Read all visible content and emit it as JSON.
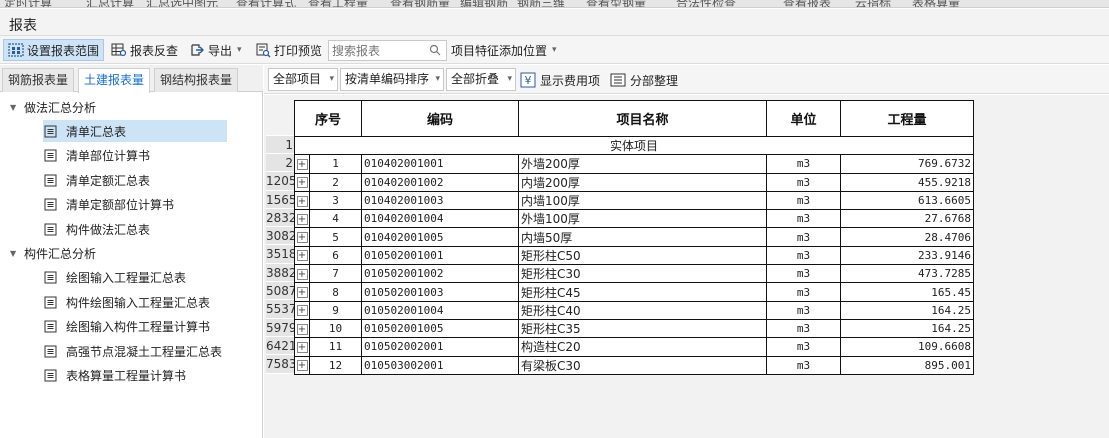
{
  "top_menu": [
    "定时计算",
    "汇总计算",
    "汇总选中图元",
    "查看计算式",
    "查看工程量",
    "查看钢筋量",
    "编辑钢筋",
    "钢筋三维",
    "查看型钢量",
    "合法性检查",
    "查看报表",
    "云指标",
    "表格算量"
  ],
  "window_title": "报表",
  "toolbar": {
    "set_range": "设置报表范围",
    "reverse_check": "报表反查",
    "export": "导出",
    "print_preview": "打印预览",
    "search_placeholder": "搜索报表",
    "feature_position": "项目特征添加位置"
  },
  "left_tabs": [
    "钢筋报表量",
    "土建报表量",
    "钢结构报表量"
  ],
  "tree": {
    "group1": "做法汇总分析",
    "group1_items": [
      "清单汇总表",
      "清单部位计算书",
      "清单定额汇总表",
      "清单定额部位计算书",
      "构件做法汇总表"
    ],
    "group2": "构件汇总分析",
    "group2_items": [
      "绘图输入工程量汇总表",
      "构件绘图输入工程量汇总表",
      "绘图输入构件工程量计算书",
      "高强节点混凝土工程量汇总表",
      "表格算量工程量计算书"
    ]
  },
  "right_toolbar": {
    "all_items": "全部项目",
    "sort": "按清单编码排序",
    "fold": "全部折叠",
    "show_fee": "显示费用项",
    "part_sort": "分部整理"
  },
  "table": {
    "headers": [
      "序号",
      "编码",
      "项目名称",
      "单位",
      "工程量"
    ],
    "section_title": "实体项目",
    "section_rownum": "1",
    "rows": [
      {
        "rownum": "2",
        "no": "1",
        "code": "010402001001",
        "name": "外墙200厚",
        "unit": "m3",
        "qty": "769.6732"
      },
      {
        "rownum": "1205",
        "no": "2",
        "code": "010402001002",
        "name": "内墙200厚",
        "unit": "m3",
        "qty": "455.9218"
      },
      {
        "rownum": "1565",
        "no": "3",
        "code": "010402001003",
        "name": "内墙100厚",
        "unit": "m3",
        "qty": "613.6605"
      },
      {
        "rownum": "2832",
        "no": "4",
        "code": "010402001004",
        "name": "外墙100厚",
        "unit": "m3",
        "qty": "27.6768"
      },
      {
        "rownum": "3082",
        "no": "5",
        "code": "010402001005",
        "name": "内墙50厚",
        "unit": "m3",
        "qty": "28.4706"
      },
      {
        "rownum": "3518",
        "no": "6",
        "code": "010502001001",
        "name": "矩形柱C50",
        "unit": "m3",
        "qty": "233.9146"
      },
      {
        "rownum": "3882",
        "no": "7",
        "code": "010502001002",
        "name": "矩形柱C30",
        "unit": "m3",
        "qty": "473.7285"
      },
      {
        "rownum": "5087",
        "no": "8",
        "code": "010502001003",
        "name": "矩形柱C45",
        "unit": "m3",
        "qty": "165.45"
      },
      {
        "rownum": "5537",
        "no": "9",
        "code": "010502001004",
        "name": "矩形柱C40",
        "unit": "m3",
        "qty": "164.25"
      },
      {
        "rownum": "5979",
        "no": "10",
        "code": "010502001005",
        "name": "矩形柱C35",
        "unit": "m3",
        "qty": "164.25"
      },
      {
        "rownum": "6421",
        "no": "11",
        "code": "010502002001",
        "name": "构造柱C20",
        "unit": "m3",
        "qty": "109.6608"
      },
      {
        "rownum": "7583",
        "no": "12",
        "code": "010503002001",
        "name": "有梁板C30",
        "unit": "m3",
        "qty": "895.001"
      }
    ]
  },
  "colors": {
    "accent": "#1a6fc9",
    "selected": "#cde4f7"
  }
}
